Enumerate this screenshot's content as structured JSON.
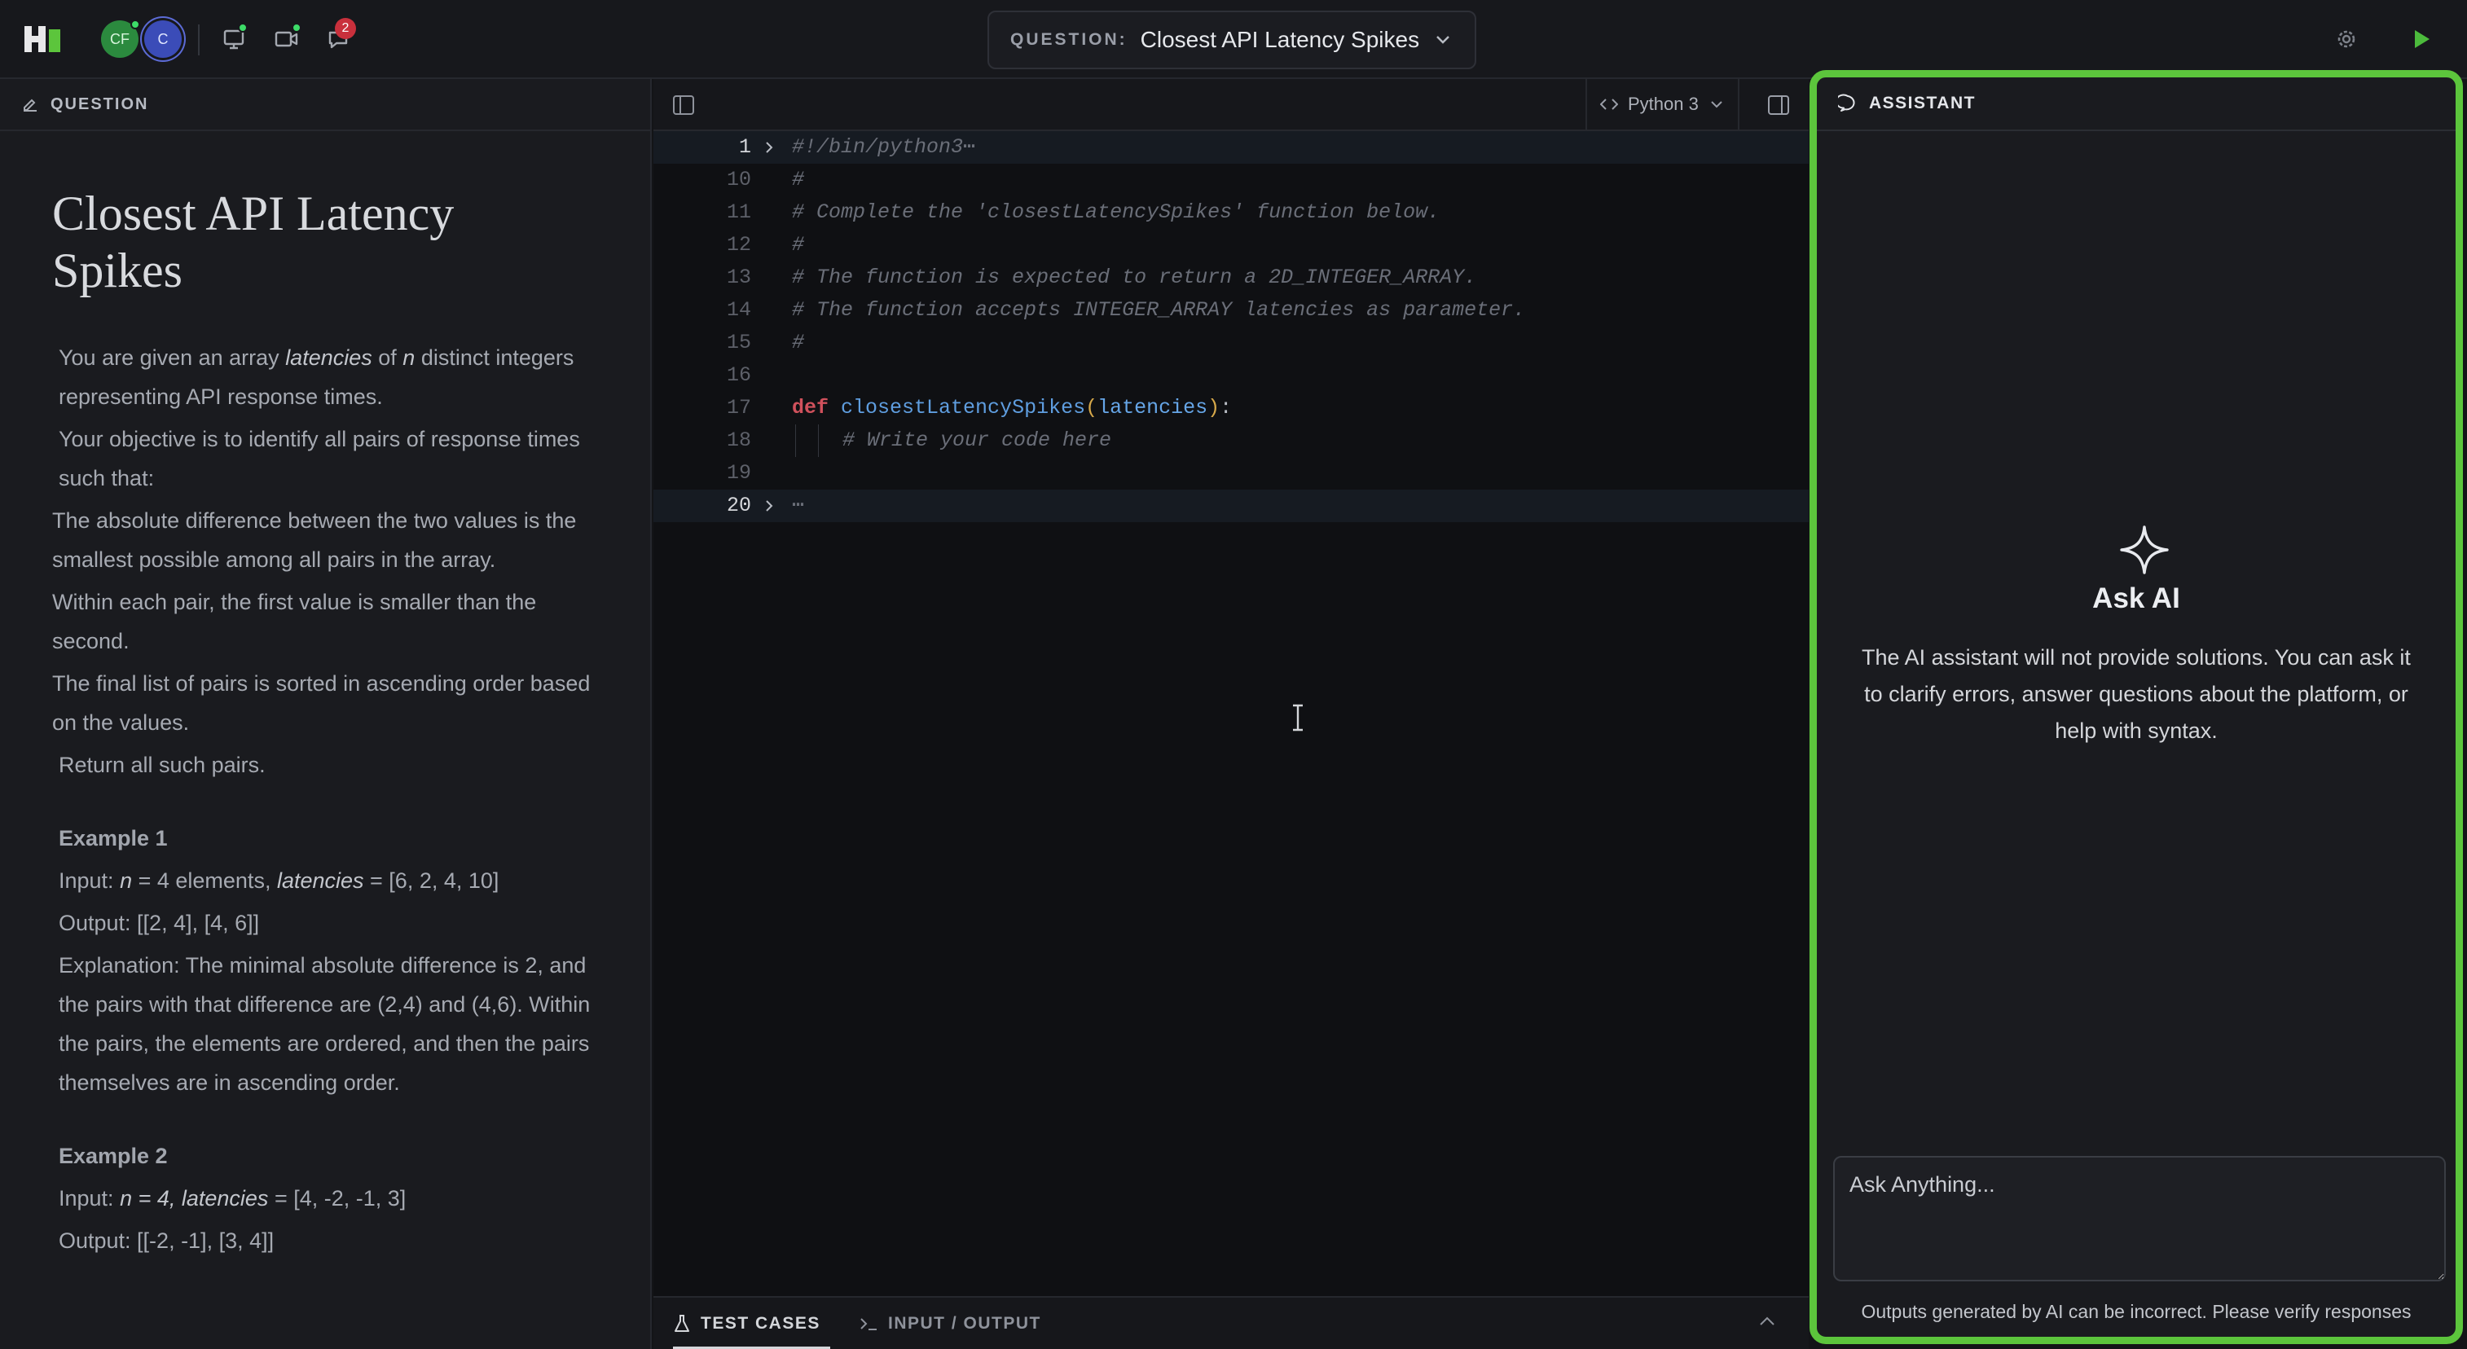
{
  "topbar": {
    "avatar_cf": "CF",
    "avatar_c": "C",
    "notification_count": "2",
    "question_label": "QUESTION:",
    "question_title": "Closest API Latency Spikes"
  },
  "left_panel": {
    "header_label": "QUESTION",
    "title": "Closest API Latency Spikes",
    "intro_pre": "You are given an array ",
    "intro_var1": "latencies",
    "intro_mid": " of ",
    "intro_var2": "n",
    "intro_post": " distinct integers representing API response times.",
    "objective": "Your objective is to identify all pairs of response times such that:",
    "rule1": "The absolute difference between the two values is the smallest possible among all pairs in the array.",
    "rule2": "Within each pair, the first value is smaller than the second.",
    "rule3": "The final list of pairs is sorted in ascending order based on the values.",
    "return_text": "Return all such pairs.",
    "example1": {
      "title": "Example 1",
      "input_pre": "Input: ",
      "input_n": "n",
      "input_mid": " = 4 elements, ",
      "input_var": "latencies",
      "input_post": " = [6, 2, 4, 10]",
      "output": "Output: [[2, 4], [4, 6]]",
      "explanation": "Explanation: The minimal absolute difference is 2, and the pairs with that difference are (2,4) and (4,6). Within the pairs, the elements are ordered, and then the pairs themselves are in ascending order."
    },
    "example2": {
      "title": "Example 2",
      "input_pre": "Input: ",
      "input_italic": "n = 4, latencies",
      "input_post": " = [4, -2, -1, 3]",
      "output": "Output: [[-2, -1], [3, 4]]"
    }
  },
  "editor": {
    "language": "Python 3",
    "lines": [
      {
        "num": "1",
        "text": "#!/bin/python3"
      },
      {
        "num": "10",
        "text": "#"
      },
      {
        "num": "11",
        "text": "# Complete the 'closestLatencySpikes' function below."
      },
      {
        "num": "12",
        "text": "#"
      },
      {
        "num": "13",
        "text": "# The function is expected to return a 2D_INTEGER_ARRAY."
      },
      {
        "num": "14",
        "text": "# The function accepts INTEGER_ARRAY latencies as parameter."
      },
      {
        "num": "15",
        "text": "#"
      },
      {
        "num": "16",
        "text": ""
      },
      {
        "num": "17",
        "kw": "def",
        "fn": "closestLatencySpikes",
        "param": "latencies"
      },
      {
        "num": "18",
        "text": "# Write your code here"
      },
      {
        "num": "19",
        "text": ""
      },
      {
        "num": "20",
        "text": "⋯"
      }
    ],
    "ellipsis": "⋯",
    "bottom_tabs": {
      "test_cases": "TEST CASES",
      "input_output": "INPUT / OUTPUT"
    }
  },
  "assistant": {
    "header_label": "ASSISTANT",
    "title": "Ask AI",
    "description": "The AI assistant will not provide solutions. You can ask it to clarify errors, answer questions about the platform, or help with syntax.",
    "input_placeholder": "Ask Anything...",
    "disclaimer": "Outputs generated by AI can be incorrect. Please verify responses"
  },
  "colors": {
    "accent_green": "#5cc53c",
    "badge_red": "#c9303c",
    "keyword_red": "#d0515c",
    "function_blue": "#5f9ee0"
  },
  "icons": [
    "logo-icon",
    "screen-share-icon",
    "video-icon",
    "chat-icon",
    "settings-icon",
    "run-icon",
    "edit-icon",
    "sidebar-toggle-icon",
    "code-icon",
    "chevron-down-icon",
    "flask-icon",
    "terminal-icon",
    "chevron-up-icon",
    "chat-bubble-icon",
    "sparkle-icon"
  ]
}
